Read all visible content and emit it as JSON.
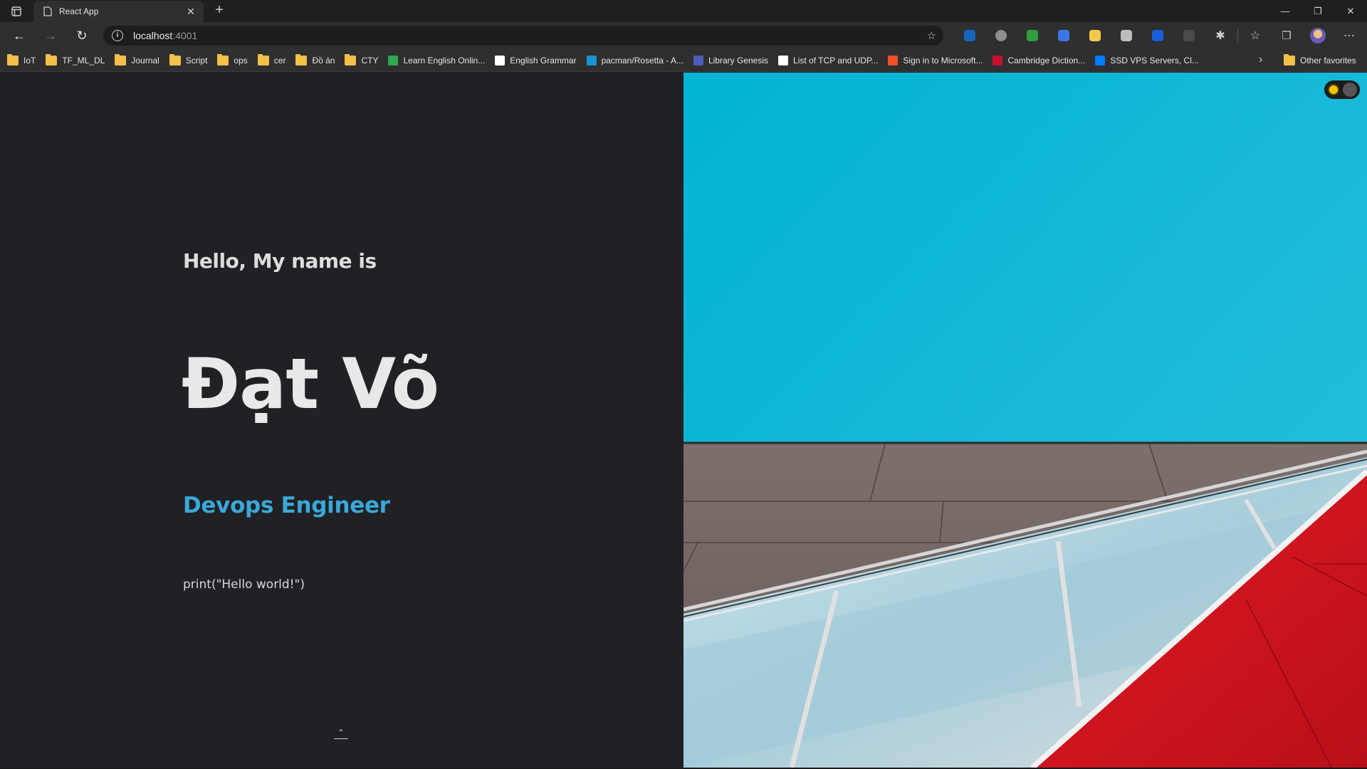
{
  "browser": {
    "tab_title": "React App",
    "url_host": "localhost",
    "url_port": ":4001",
    "bookmarks": [
      {
        "label": "IoT",
        "icon": "folder-icon"
      },
      {
        "label": "TF_ML_DL",
        "icon": "folder-icon"
      },
      {
        "label": "Journal",
        "icon": "folder-icon"
      },
      {
        "label": "Script",
        "icon": "folder-icon"
      },
      {
        "label": "ops",
        "icon": "folder-icon"
      },
      {
        "label": "cer",
        "icon": "folder-icon"
      },
      {
        "label": "Đồ án",
        "icon": "folder-icon"
      },
      {
        "label": "CTY",
        "icon": "folder-icon"
      },
      {
        "label": "Learn English Onlin...",
        "icon": "clover-icon"
      },
      {
        "label": "English Grammar",
        "icon": "checkbox-icon"
      },
      {
        "label": "pacman/Rosetta - A...",
        "icon": "arch-icon"
      },
      {
        "label": "Library Genesis",
        "icon": "book-icon"
      },
      {
        "label": "List of TCP and UDP...",
        "icon": "wikipedia-icon"
      },
      {
        "label": "Sign in to Microsoft...",
        "icon": "microsoft-icon"
      },
      {
        "label": "Cambridge Diction...",
        "icon": "cambridge-icon"
      },
      {
        "label": "SSD VPS Servers, Cl...",
        "icon": "vultr-icon"
      }
    ],
    "other_favorites": "Other favorites"
  },
  "page": {
    "greeting": "Hello, My name is",
    "name": "Đạt Võ",
    "role": "Devops Engineer",
    "code": "print(\"Hello world!\")"
  },
  "colors": {
    "background": "#202124",
    "accent": "#3aa8d8",
    "sky": "#06b4d4",
    "panel_red": "#d8141f"
  }
}
